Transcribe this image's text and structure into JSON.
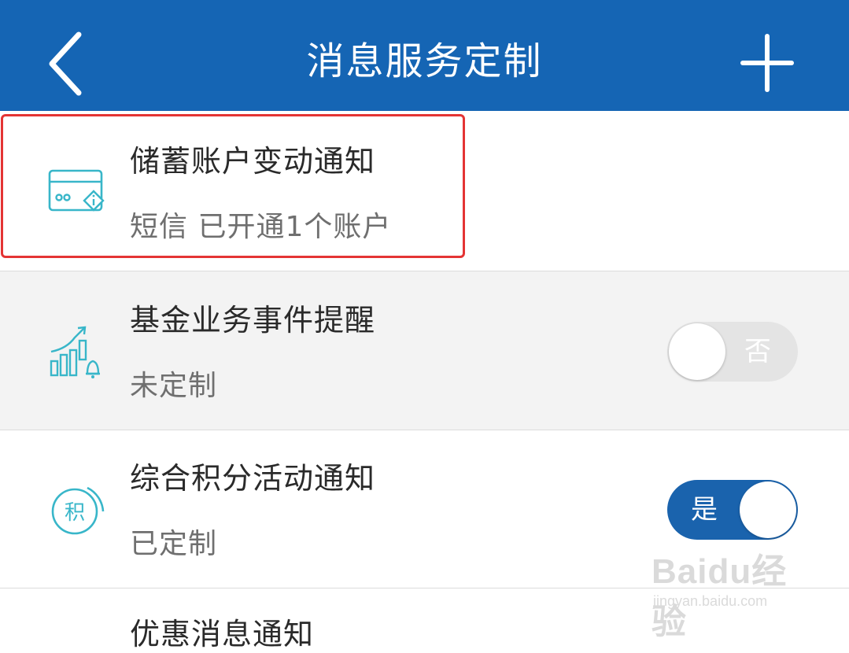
{
  "header": {
    "title": "消息服务定制",
    "back_icon": "chevron-left-icon",
    "add_icon": "plus-icon"
  },
  "items": [
    {
      "title": "储蓄账户变动通知",
      "subtitle": "短信 已开通1个账户",
      "icon": "bank-card-info-icon",
      "highlighted": true
    },
    {
      "title": "基金业务事件提醒",
      "subtitle": "未定制",
      "icon": "fund-chart-bell-icon",
      "toggle": {
        "label": "否",
        "on": false
      }
    },
    {
      "title": "综合积分活动通知",
      "subtitle": "已定制",
      "icon": "points-circle-icon",
      "icon_text": "积",
      "toggle": {
        "label": "是",
        "on": true
      }
    },
    {
      "title": "优惠消息通知"
    }
  ],
  "watermark": {
    "brand": "Baidu经验",
    "url": "jingyan.baidu.com"
  },
  "colors": {
    "header_bg": "#1565b4",
    "accent": "#1a63ad",
    "icon": "#38b6c9",
    "highlight_border": "#e43434"
  }
}
